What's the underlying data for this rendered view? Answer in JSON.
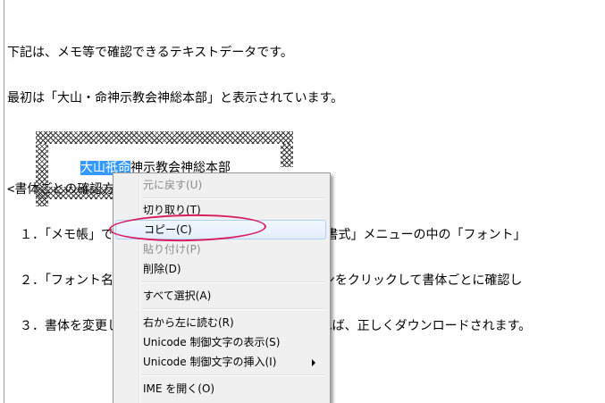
{
  "document": {
    "lines": [
      "下記は、メモ等で確認できるテキストデータです。",
      "最初は「大山・命神示教会神総本部」と表示されています。",
      "",
      "<書体ごとの確認方法>",
      "　１．「メモ帳」で開いている場合は、メニューバーの「書式」メニューの中の「フォント」",
      "　２．「フォント名」の各フォントを選択し、「OK」ボタンをクリックして書体ごとに確認し",
      "　３．書体を変更して「ねず」の文字が正しく表示されれば、正しくダウンロードされます。"
    ],
    "box_text_selected": "大山祇命",
    "box_text_rest": "神示教会神総本部"
  },
  "context_menu": {
    "items": [
      {
        "label": "元に戻す(U)",
        "enabled": false
      },
      {
        "label": "切り取り(T)",
        "enabled": true
      },
      {
        "label": "コピー(C)",
        "enabled": true,
        "highlighted": true
      },
      {
        "label": "貼り付け(P)",
        "enabled": false
      },
      {
        "label": "削除(D)",
        "enabled": true
      },
      {
        "label": "すべて選択(A)",
        "enabled": true
      },
      {
        "label": "右から左に読む(R)",
        "enabled": true
      },
      {
        "label": "Unicode 制御文字の表示(S)",
        "enabled": true
      },
      {
        "label": "Unicode 制御文字の挿入(I)",
        "enabled": true,
        "submenu": true
      },
      {
        "label": "IME を開く(O)",
        "enabled": true
      }
    ]
  },
  "colors": {
    "selection": "#3399ff",
    "annotation_ring": "#d81b60"
  }
}
